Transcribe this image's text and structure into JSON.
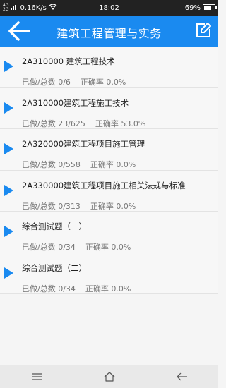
{
  "status_bar": {
    "network_top": "4G",
    "network_bottom": "2G",
    "speed": "0.16K/s",
    "time": "18:02",
    "battery": "69%",
    "battery_level": 0.69
  },
  "header": {
    "title": "建筑工程管理与实务",
    "back_icon": "back-arrow-icon",
    "edit_icon": "edit-icon"
  },
  "chapters": [
    {
      "name": "2A310000   建筑工程技术",
      "progress": "已做/总数 0/6",
      "accuracy": "正确率 0.0%"
    },
    {
      "name": "2A310000建筑工程施工技术",
      "progress": "已做/总数 23/625",
      "accuracy": "正确率 53.0%"
    },
    {
      "name": "2A320000建筑工程项目施工管理",
      "progress": "已做/总数 0/558",
      "accuracy": "正确率 0.0%"
    },
    {
      "name": "2A330000建筑工程项目施工相关法规与标准",
      "progress": "已做/总数 0/313",
      "accuracy": "正确率 0.0%"
    },
    {
      "name": "综合测试题（一）",
      "progress": "已做/总数 0/34",
      "accuracy": "正确率 0.0%"
    },
    {
      "name": "综合测试题（二）",
      "progress": "已做/总数 0/34",
      "accuracy": "正确率 0.0%"
    }
  ],
  "nav_bar": {
    "menu_icon": "menu-icon",
    "home_icon": "home-icon",
    "back_icon": "back-icon"
  }
}
